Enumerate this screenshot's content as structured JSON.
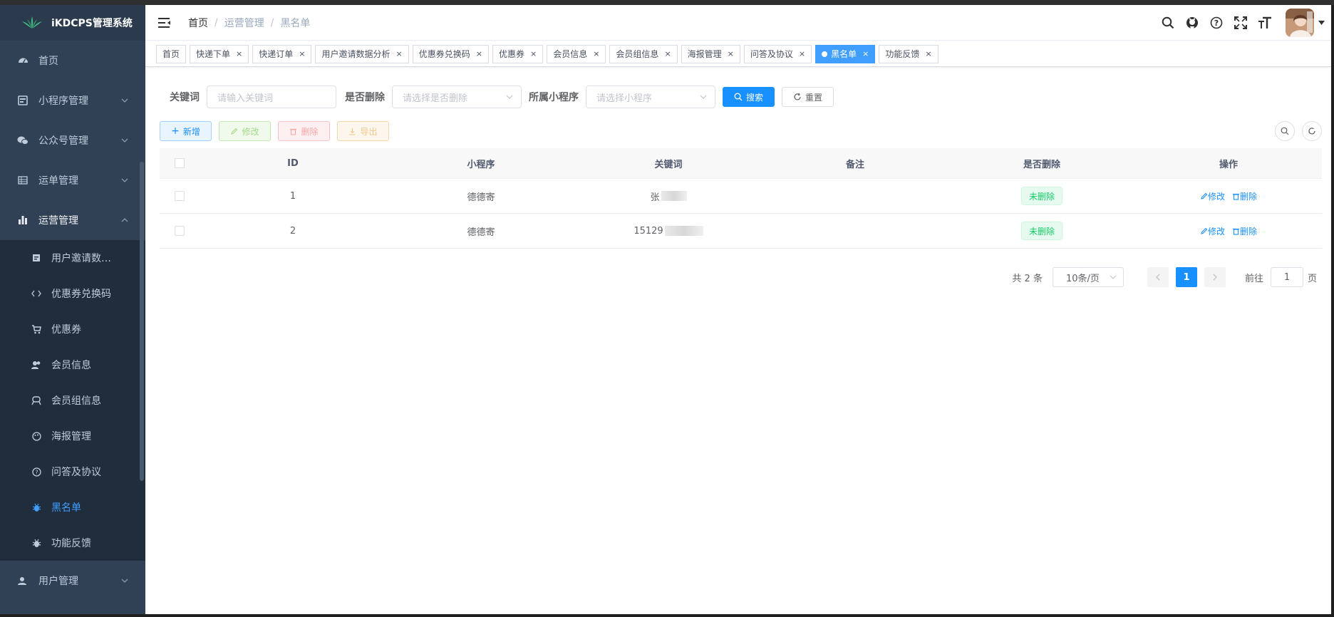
{
  "app": {
    "title": "iKDCPS管理系统"
  },
  "sidebar": {
    "items": [
      {
        "label": "首页"
      },
      {
        "label": "小程序管理"
      },
      {
        "label": "公众号管理"
      },
      {
        "label": "运单管理"
      },
      {
        "label": "运营管理"
      },
      {
        "label": "用户管理"
      }
    ],
    "sub_items": [
      {
        "label": "用户邀请数…"
      },
      {
        "label": "优惠券兑换码"
      },
      {
        "label": "优惠券"
      },
      {
        "label": "会员信息"
      },
      {
        "label": "会员组信息"
      },
      {
        "label": "海报管理"
      },
      {
        "label": "问答及协议"
      },
      {
        "label": "黑名单"
      },
      {
        "label": "功能反馈"
      }
    ]
  },
  "breadcrumb": [
    "首页",
    "运营管理",
    "黑名单"
  ],
  "breadcrumb_sep": "/",
  "tabs": [
    "首页",
    "快递下单",
    "快递订单",
    "用户邀请数据分析",
    "优惠券兑换码",
    "优惠券",
    "会员信息",
    "会员组信息",
    "海报管理",
    "问答及协议",
    "黑名单",
    "功能反馈"
  ],
  "tab_close": "×",
  "filter": {
    "keyword_label": "关键词",
    "keyword_placeholder": "请输入关键词",
    "deleted_label": "是否删除",
    "deleted_placeholder": "请选择是否删除",
    "app_label": "所属小程序",
    "app_placeholder": "请选择小程序",
    "search_label": "搜索",
    "reset_label": "重置"
  },
  "toolbar": {
    "add": "新增",
    "edit": "修改",
    "delete": "删除",
    "export": "导出"
  },
  "table": {
    "columns": [
      "ID",
      "小程序",
      "关键词",
      "备注",
      "是否删除",
      "操作"
    ],
    "rows": [
      {
        "id": "1",
        "app": "德德寄",
        "keyword": "张",
        "note": "",
        "status": "未删除",
        "edit": "修改",
        "delete": "删除"
      },
      {
        "id": "2",
        "app": "德德寄",
        "keyword": "15129",
        "note": "",
        "status": "未删除",
        "edit": "修改",
        "delete": "删除"
      }
    ]
  },
  "pagination": {
    "total": "共 2 条",
    "page_size": "10条/页",
    "current": "1",
    "goto_prefix": "前往",
    "goto_value": "1",
    "goto_suffix": "页"
  },
  "colors": {
    "sidebar_bg": "#304156",
    "primary": "#1890ff",
    "active_menu": "#409eff",
    "success": "#13ce66"
  }
}
